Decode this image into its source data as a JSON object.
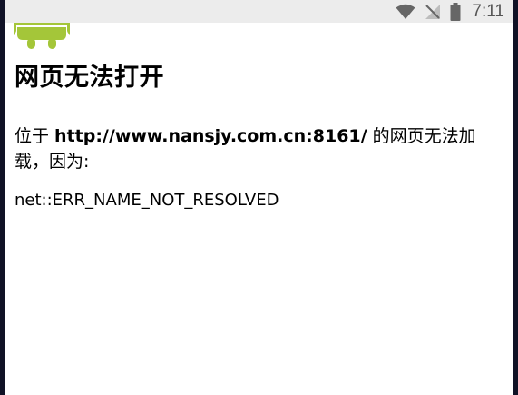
{
  "status_bar": {
    "time": "7:11",
    "icons": [
      "wifi-icon",
      "no-signal-icon",
      "battery-icon"
    ]
  },
  "page": {
    "logo": "android-robot-icon",
    "title": "网页无法打开",
    "description_prefix": "位于 ",
    "url": "http://www.nansjy.com.cn:8161/",
    "description_suffix": " 的网页无法加载，因为:",
    "error_code": "net::ERR_NAME_NOT_RESOLVED"
  },
  "colors": {
    "android_green": "#a4c639",
    "status_bar_bg": "#ececec",
    "status_icon": "#666666",
    "frame": "#101226"
  }
}
